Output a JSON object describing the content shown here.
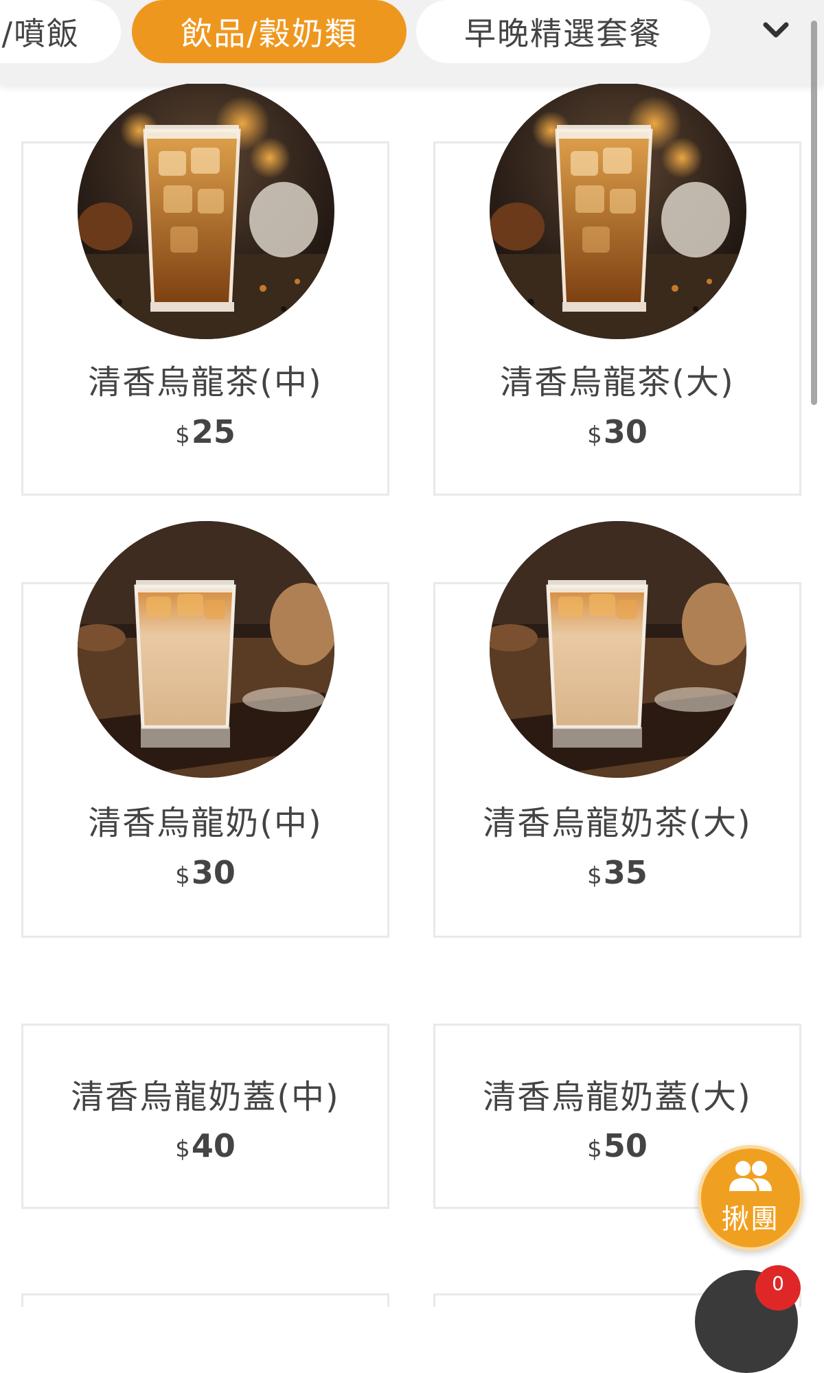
{
  "categories": [
    {
      "label": "/噴飯",
      "active": false
    },
    {
      "label": "飲品/穀奶類",
      "active": true
    },
    {
      "label": "早晚精選套餐",
      "active": false
    }
  ],
  "icons": {
    "expand": "chevron-down-icon",
    "group": "group-people-icon"
  },
  "colors": {
    "accent": "#ee971f",
    "badge": "#e02727"
  },
  "products": [
    {
      "name": "清香烏龍茶(中)",
      "currency": "$",
      "price": "25",
      "image": "iced-oolong-tea"
    },
    {
      "name": "清香烏龍茶(大)",
      "currency": "$",
      "price": "30",
      "image": "iced-oolong-tea"
    },
    {
      "name": "清香烏龍奶(中)",
      "currency": "$",
      "price": "30",
      "image": "iced-oolong-milk"
    },
    {
      "name": "清香烏龍奶茶(大)",
      "currency": "$",
      "price": "35",
      "image": "iced-oolong-milk"
    },
    {
      "name": "清香烏龍奶蓋(中)",
      "currency": "$",
      "price": "40"
    },
    {
      "name": "清香烏龍奶蓋(大)",
      "currency": "$",
      "price": "50"
    }
  ],
  "group_button": {
    "label": "揪團"
  },
  "cart": {
    "count": "0"
  }
}
